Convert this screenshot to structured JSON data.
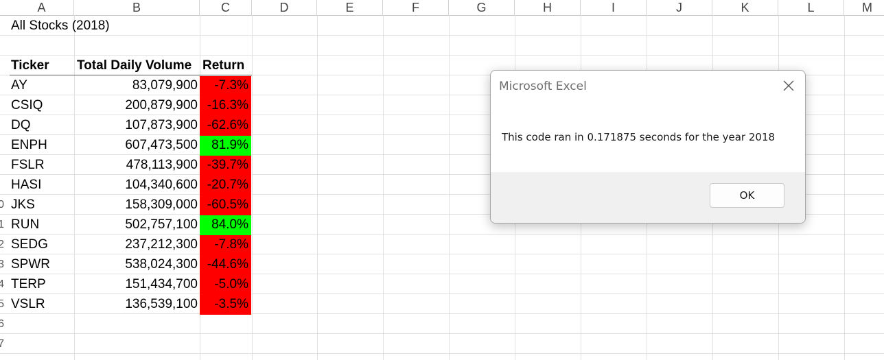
{
  "columns": [
    "A",
    "B",
    "C",
    "D",
    "E",
    "F",
    "G",
    "H",
    "I",
    "J",
    "K",
    "L",
    "M"
  ],
  "row_numbers": [
    "0",
    "1",
    "2",
    "3",
    "4",
    "5",
    "6",
    "7"
  ],
  "sheet": {
    "title": "All Stocks (2018)",
    "headers": {
      "ticker": "Ticker",
      "volume": "Total Daily Volume",
      "return": "Return"
    },
    "rows": [
      {
        "ticker": "AY",
        "volume": "83,079,900",
        "return": "-7.3%",
        "status": "negative"
      },
      {
        "ticker": "CSIQ",
        "volume": "200,879,900",
        "return": "-16.3%",
        "status": "negative"
      },
      {
        "ticker": "DQ",
        "volume": "107,873,900",
        "return": "-62.6%",
        "status": "negative"
      },
      {
        "ticker": "ENPH",
        "volume": "607,473,500",
        "return": "81.9%",
        "status": "positive"
      },
      {
        "ticker": "FSLR",
        "volume": "478,113,900",
        "return": "-39.7%",
        "status": "negative"
      },
      {
        "ticker": "HASI",
        "volume": "104,340,600",
        "return": "-20.7%",
        "status": "negative"
      },
      {
        "ticker": "JKS",
        "volume": "158,309,000",
        "return": "-60.5%",
        "status": "negative"
      },
      {
        "ticker": "RUN",
        "volume": "502,757,100",
        "return": "84.0%",
        "status": "positive"
      },
      {
        "ticker": "SEDG",
        "volume": "237,212,300",
        "return": "-7.8%",
        "status": "negative"
      },
      {
        "ticker": "SPWR",
        "volume": "538,024,300",
        "return": "-44.6%",
        "status": "negative"
      },
      {
        "ticker": "TERP",
        "volume": "151,434,700",
        "return": "-5.0%",
        "status": "negative"
      },
      {
        "ticker": "VSLR",
        "volume": "136,539,100",
        "return": "-3.5%",
        "status": "negative"
      }
    ]
  },
  "colors": {
    "negative": "#ff0000",
    "positive": "#00ff00"
  },
  "dialog": {
    "title": "Microsoft Excel",
    "message": "This code ran in 0.171875 seconds for the year 2018",
    "ok_label": "OK",
    "close_icon": "close-icon"
  }
}
